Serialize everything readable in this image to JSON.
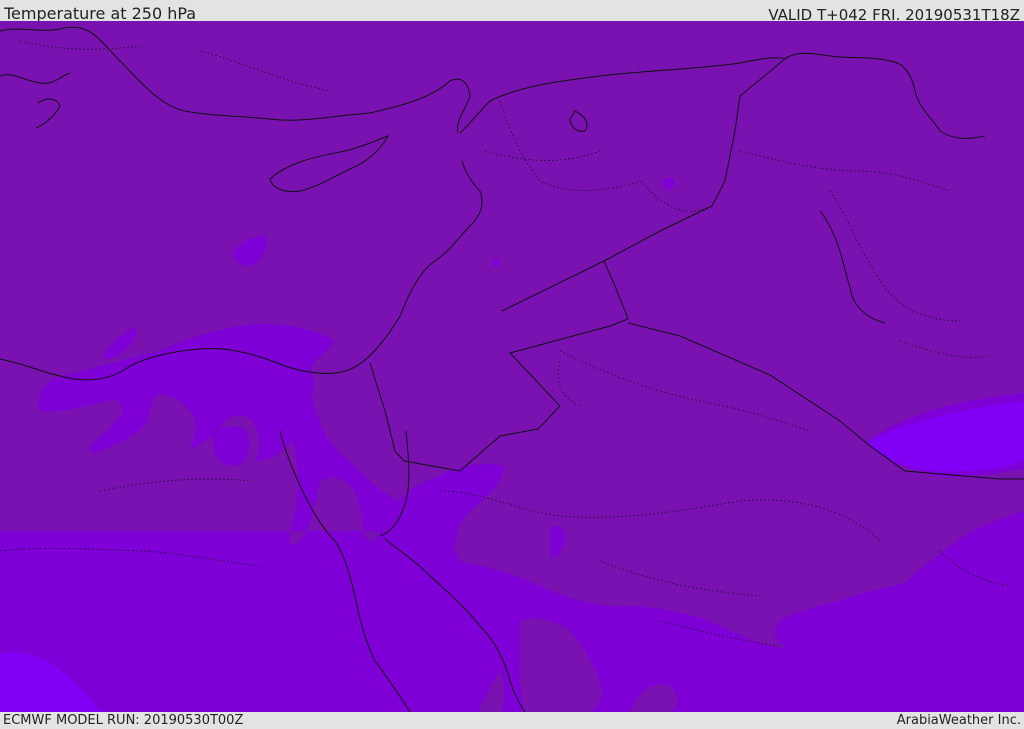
{
  "header": {
    "title": "Temperature at 250 hPa",
    "valid": "VALID T+042 FRI. 20190531T18Z"
  },
  "footer": {
    "model_run": "ECMWF MODEL RUN: 20190530T00Z",
    "credit": "ArabiaWeather Inc."
  },
  "map": {
    "colors": {
      "warm_band": "#7a12b2",
      "mid_band": "#7e00d6",
      "cold_band": "#8000f6",
      "boundaries": "#111111"
    }
  }
}
